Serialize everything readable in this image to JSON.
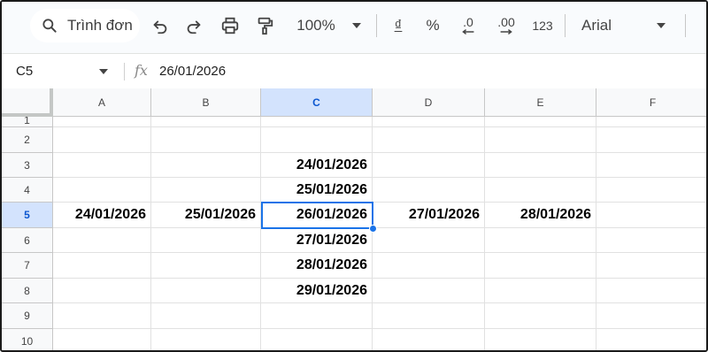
{
  "toolbar": {
    "menu_search": "Trình đơn",
    "zoom": "100%",
    "currency": "₫",
    "percent": "%",
    "decrease_decimal": ".0",
    "increase_decimal": ".00",
    "number_format": "123",
    "font": "Arial"
  },
  "formula_bar": {
    "cell_ref": "C5",
    "fx": "fx",
    "value": "26/01/2026"
  },
  "grid": {
    "columns": [
      "A",
      "B",
      "C",
      "D",
      "E",
      "F"
    ],
    "rows": [
      "1",
      "2",
      "3",
      "4",
      "5",
      "6",
      "7",
      "8",
      "9",
      "10"
    ],
    "selected_column": "C",
    "selected_row": "5",
    "cells": {
      "C3": "24/01/2026",
      "C4": "25/01/2026",
      "A5": "24/01/2026",
      "B5": "25/01/2026",
      "C5": "26/01/2026",
      "D5": "27/01/2026",
      "E5": "28/01/2026",
      "C6": "27/01/2026",
      "C7": "28/01/2026",
      "C8": "29/01/2026"
    }
  },
  "colors": {
    "selection": "#1a73e8",
    "header_selected_bg": "#d3e3fd"
  }
}
